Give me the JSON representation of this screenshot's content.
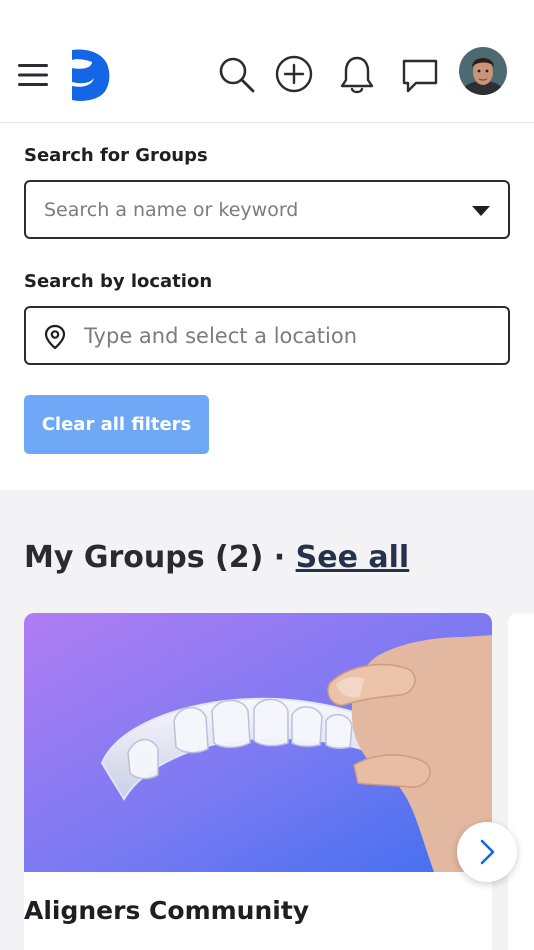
{
  "header": {
    "icons": [
      "menu-icon",
      "app-logo",
      "search-icon",
      "add-circle-icon",
      "bell-icon",
      "chat-icon",
      "avatar"
    ]
  },
  "filters": {
    "group_search_label": "Search for Groups",
    "group_search_placeholder": "Search a name or keyword",
    "location_label": "Search by location",
    "location_placeholder": "Type and select a location",
    "clear_button": "Clear all filters",
    "accent_color": "#6fa8f7"
  },
  "my_groups": {
    "title": "My Groups (2)",
    "separator": "·",
    "see_all": "See all",
    "cards": [
      {
        "name": "Aligners Community"
      }
    ]
  },
  "colors": {
    "card_gradient_start": "#b07cf2",
    "card_gradient_end": "#3f6ff0",
    "brand_blue": "#1466e6"
  }
}
